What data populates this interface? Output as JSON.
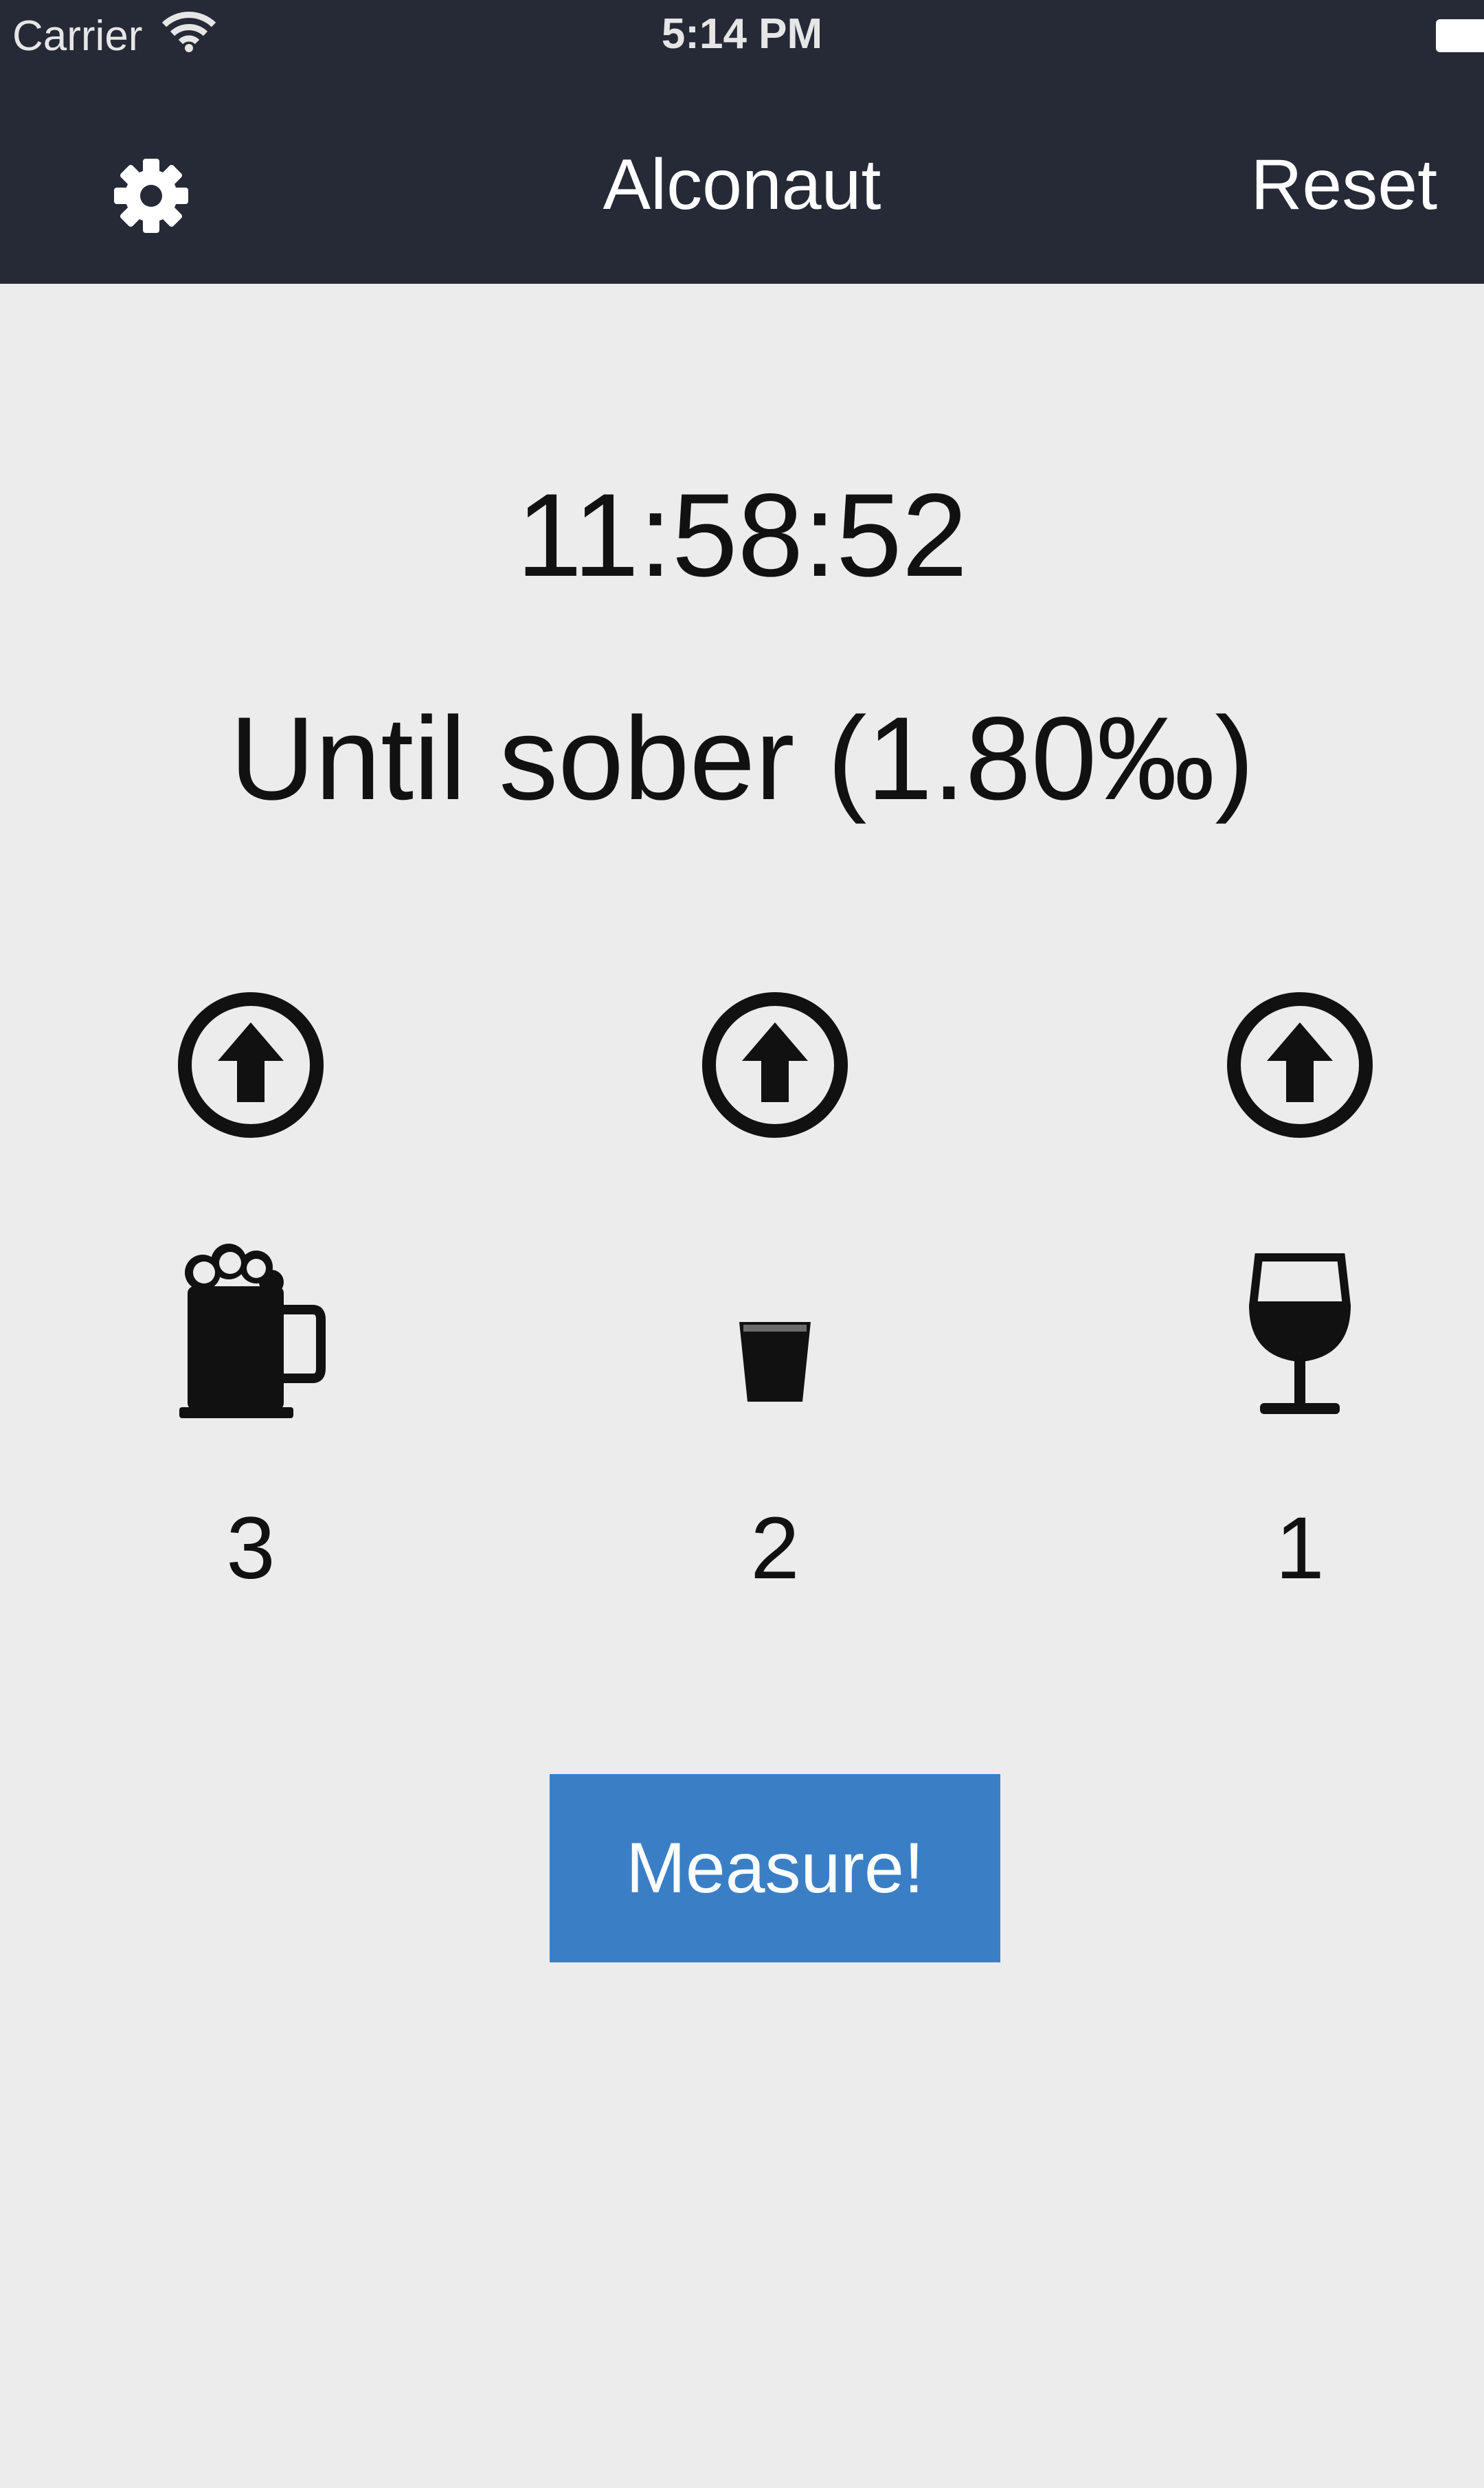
{
  "status_bar": {
    "carrier": "Carrier",
    "time": "5:14 PM",
    "wifi_icon": "wifi-icon",
    "battery_icon": "battery-icon"
  },
  "nav": {
    "settings_icon": "gear-icon",
    "title": "Alconaut",
    "reset_label": "Reset"
  },
  "timer": "11:58:52",
  "status_text": "Until sober (1.80‰)",
  "drinks": [
    {
      "type": "beer",
      "icon": "beer-mug-icon",
      "count": "3"
    },
    {
      "type": "shot",
      "icon": "shot-glass-icon",
      "count": "2"
    },
    {
      "type": "wine",
      "icon": "wine-glass-icon",
      "count": "1"
    }
  ],
  "measure_label": "Measure!",
  "colors": {
    "topbar": "#262a36",
    "background": "#ececec",
    "accent": "#3a7fc6"
  }
}
